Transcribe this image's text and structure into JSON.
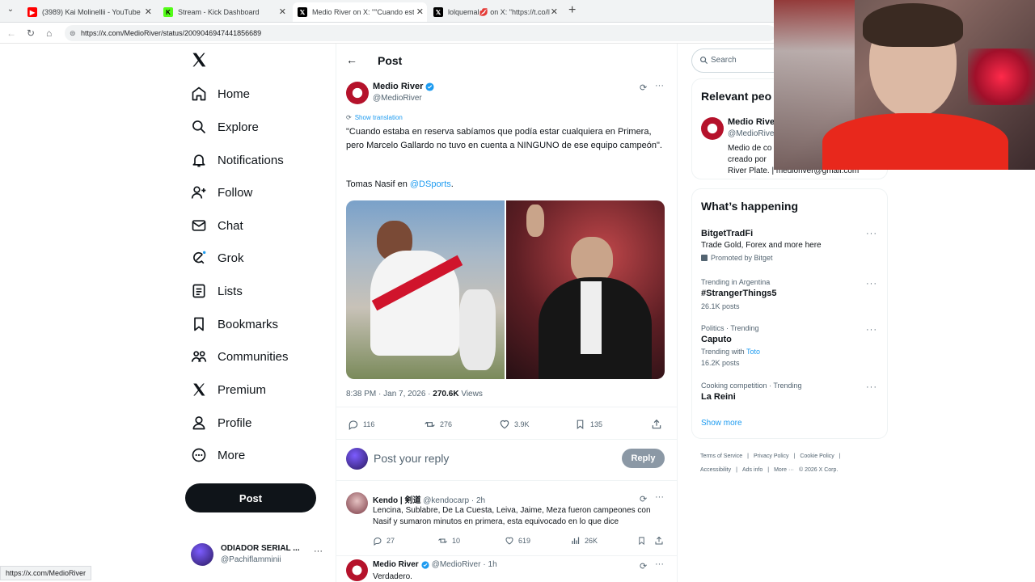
{
  "browser": {
    "tabs": [
      {
        "title": "(3989) Kai Molinellii - YouTube",
        "favicon": "youtube-icon",
        "color": "#ff0000"
      },
      {
        "title": "Stream - Kick Dashboard",
        "favicon": "kick-icon",
        "color": "#53fc18"
      },
      {
        "title": "Medio River on X: \"\"Cuando estab",
        "favicon": "x-icon",
        "color": "#000000"
      },
      {
        "title": "lolquemal💋 on X: \"https://t.co/lP",
        "favicon": "x-icon",
        "color": "#000000"
      }
    ],
    "url": "https://x.com/MedioRiver/status/2009046947441856689",
    "status_url": "https://x.com/MedioRiver"
  },
  "nav": {
    "items": [
      {
        "label": "Home",
        "icon": "home-icon"
      },
      {
        "label": "Explore",
        "icon": "search-icon"
      },
      {
        "label": "Notifications",
        "icon": "bell-icon"
      },
      {
        "label": "Follow",
        "icon": "follow-icon"
      },
      {
        "label": "Chat",
        "icon": "mail-icon"
      },
      {
        "label": "Grok",
        "icon": "grok-icon"
      },
      {
        "label": "Lists",
        "icon": "lists-icon"
      },
      {
        "label": "Bookmarks",
        "icon": "bookmark-icon"
      },
      {
        "label": "Communities",
        "icon": "communities-icon"
      },
      {
        "label": "Premium",
        "icon": "x-icon"
      },
      {
        "label": "Profile",
        "icon": "profile-icon"
      },
      {
        "label": "More",
        "icon": "more-icon"
      }
    ],
    "post_label": "Post",
    "account": {
      "name": "ODIADOR SERIAL ...",
      "handle": "@Pachiflamminii"
    }
  },
  "header": {
    "title": "Post"
  },
  "tweet": {
    "author": "Medio River",
    "handle": "@MedioRiver",
    "show_translation": "Show translation",
    "text": "\"Cuando estaba en reserva sabíamos que podía estar cualquiera en Primera, pero Marcelo Gallardo no tuvo en cuenta a NINGUNO de ese equipo campeón\".",
    "credit_prefix": "Tomas Nasif en",
    "credit_mention": "@DSports",
    "credit_suffix": ".",
    "time": "8:38 PM · Jan 7, 2026 ·",
    "views_count": "270.6K",
    "views_label": "Views",
    "replies": "116",
    "reposts": "276",
    "likes": "3.9K",
    "bookmarks": "135"
  },
  "reply_box": {
    "placeholder": "Post your reply",
    "button": "Reply"
  },
  "replies": [
    {
      "author": "Kendo | 剣道",
      "handle": "@kendocarp",
      "time": "· 2h",
      "text": "Lencina, Sublabre, De La Cuesta, Leiva, Jaime, Meza fueron campeones con Nasif y sumaron minutos en primera, esta equivocado en lo que dice",
      "replies": "27",
      "reposts": "10",
      "likes": "619",
      "views": "26K"
    },
    {
      "author": "Medio River",
      "handle": "@MedioRiver",
      "time": "· 1h",
      "text": "Verdadero."
    }
  ],
  "sidebar": {
    "search_placeholder": "Search",
    "relevant": {
      "title": "Relevant peo",
      "name": "Medio Rive",
      "handle": "@MedioRive",
      "bio_lines": [
        "Medio de co",
        "creado por ",
        "River Plate. | medioriver@gmail.com"
      ]
    },
    "happening": {
      "title": "What’s happening",
      "trends": [
        {
          "name": "BitgetTradFi",
          "desc": "Trade Gold, Forex and more here",
          "promo": "Promoted by Bitget"
        },
        {
          "meta": "Trending in Argentina",
          "name": "#StrangerThings5",
          "posts": "26.1K posts"
        },
        {
          "meta": "Politics · Trending",
          "name": "Caputo",
          "with_prefix": "Trending with",
          "with_link": "Toto",
          "posts": "16.2K posts"
        },
        {
          "meta": "Cooking competition · Trending",
          "name": "La Reini"
        }
      ],
      "show_more": "Show more"
    },
    "footer": {
      "row1": [
        "Terms of Service",
        "|",
        "Privacy Policy",
        "|",
        "Cookie Policy",
        "|"
      ],
      "row2": [
        "Accessibility",
        "|",
        "Ads info",
        "|",
        "More ···",
        "© 2026 X Corp."
      ]
    }
  },
  "colors": {
    "accent": "#1d9bf0",
    "brand_red": "#b5122b",
    "dark": "#0f1419",
    "muted": "#536471"
  }
}
